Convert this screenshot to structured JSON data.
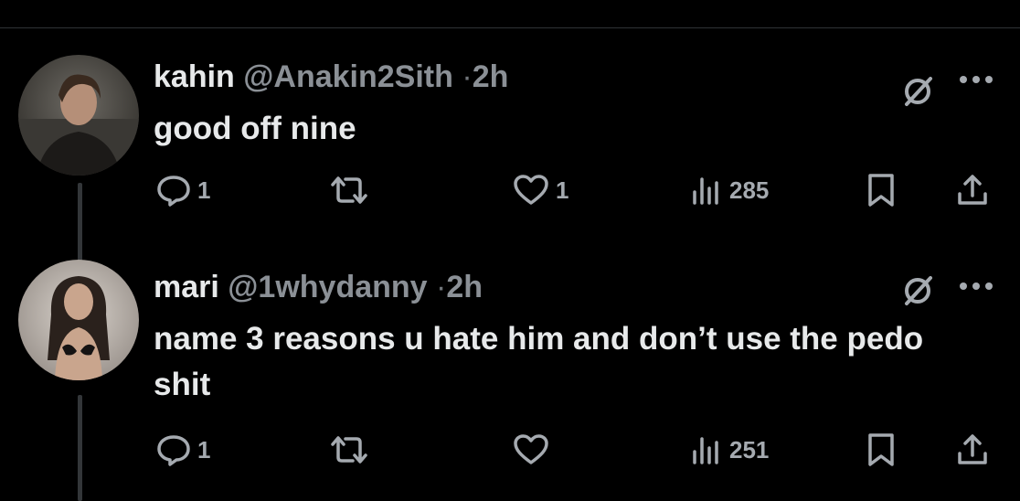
{
  "tweets": [
    {
      "name": "kahin",
      "handle": "@Anakin2Sith",
      "separator": "·",
      "time": "2h",
      "text": "good off nine",
      "reply_count": "1",
      "retweet_count": "",
      "like_count": "1",
      "view_count": "285",
      "avatar": "avatar-anakin"
    },
    {
      "name": "mari",
      "handle": "@1whydanny",
      "separator": "·",
      "time": "2h",
      "text": "name 3 reasons u hate him and don’t use the pedo shit",
      "reply_count": "1",
      "retweet_count": "",
      "like_count": "",
      "view_count": "251",
      "avatar": "avatar-woman"
    }
  ],
  "colors": {
    "background": "#000000",
    "text": "#e7e9ea",
    "secondary": "#71767b",
    "divider": "#2f3336"
  },
  "icons": [
    "reply-icon",
    "retweet-icon",
    "like-icon",
    "views-icon",
    "bookmark-icon",
    "share-icon",
    "grok-icon",
    "more-icon"
  ]
}
